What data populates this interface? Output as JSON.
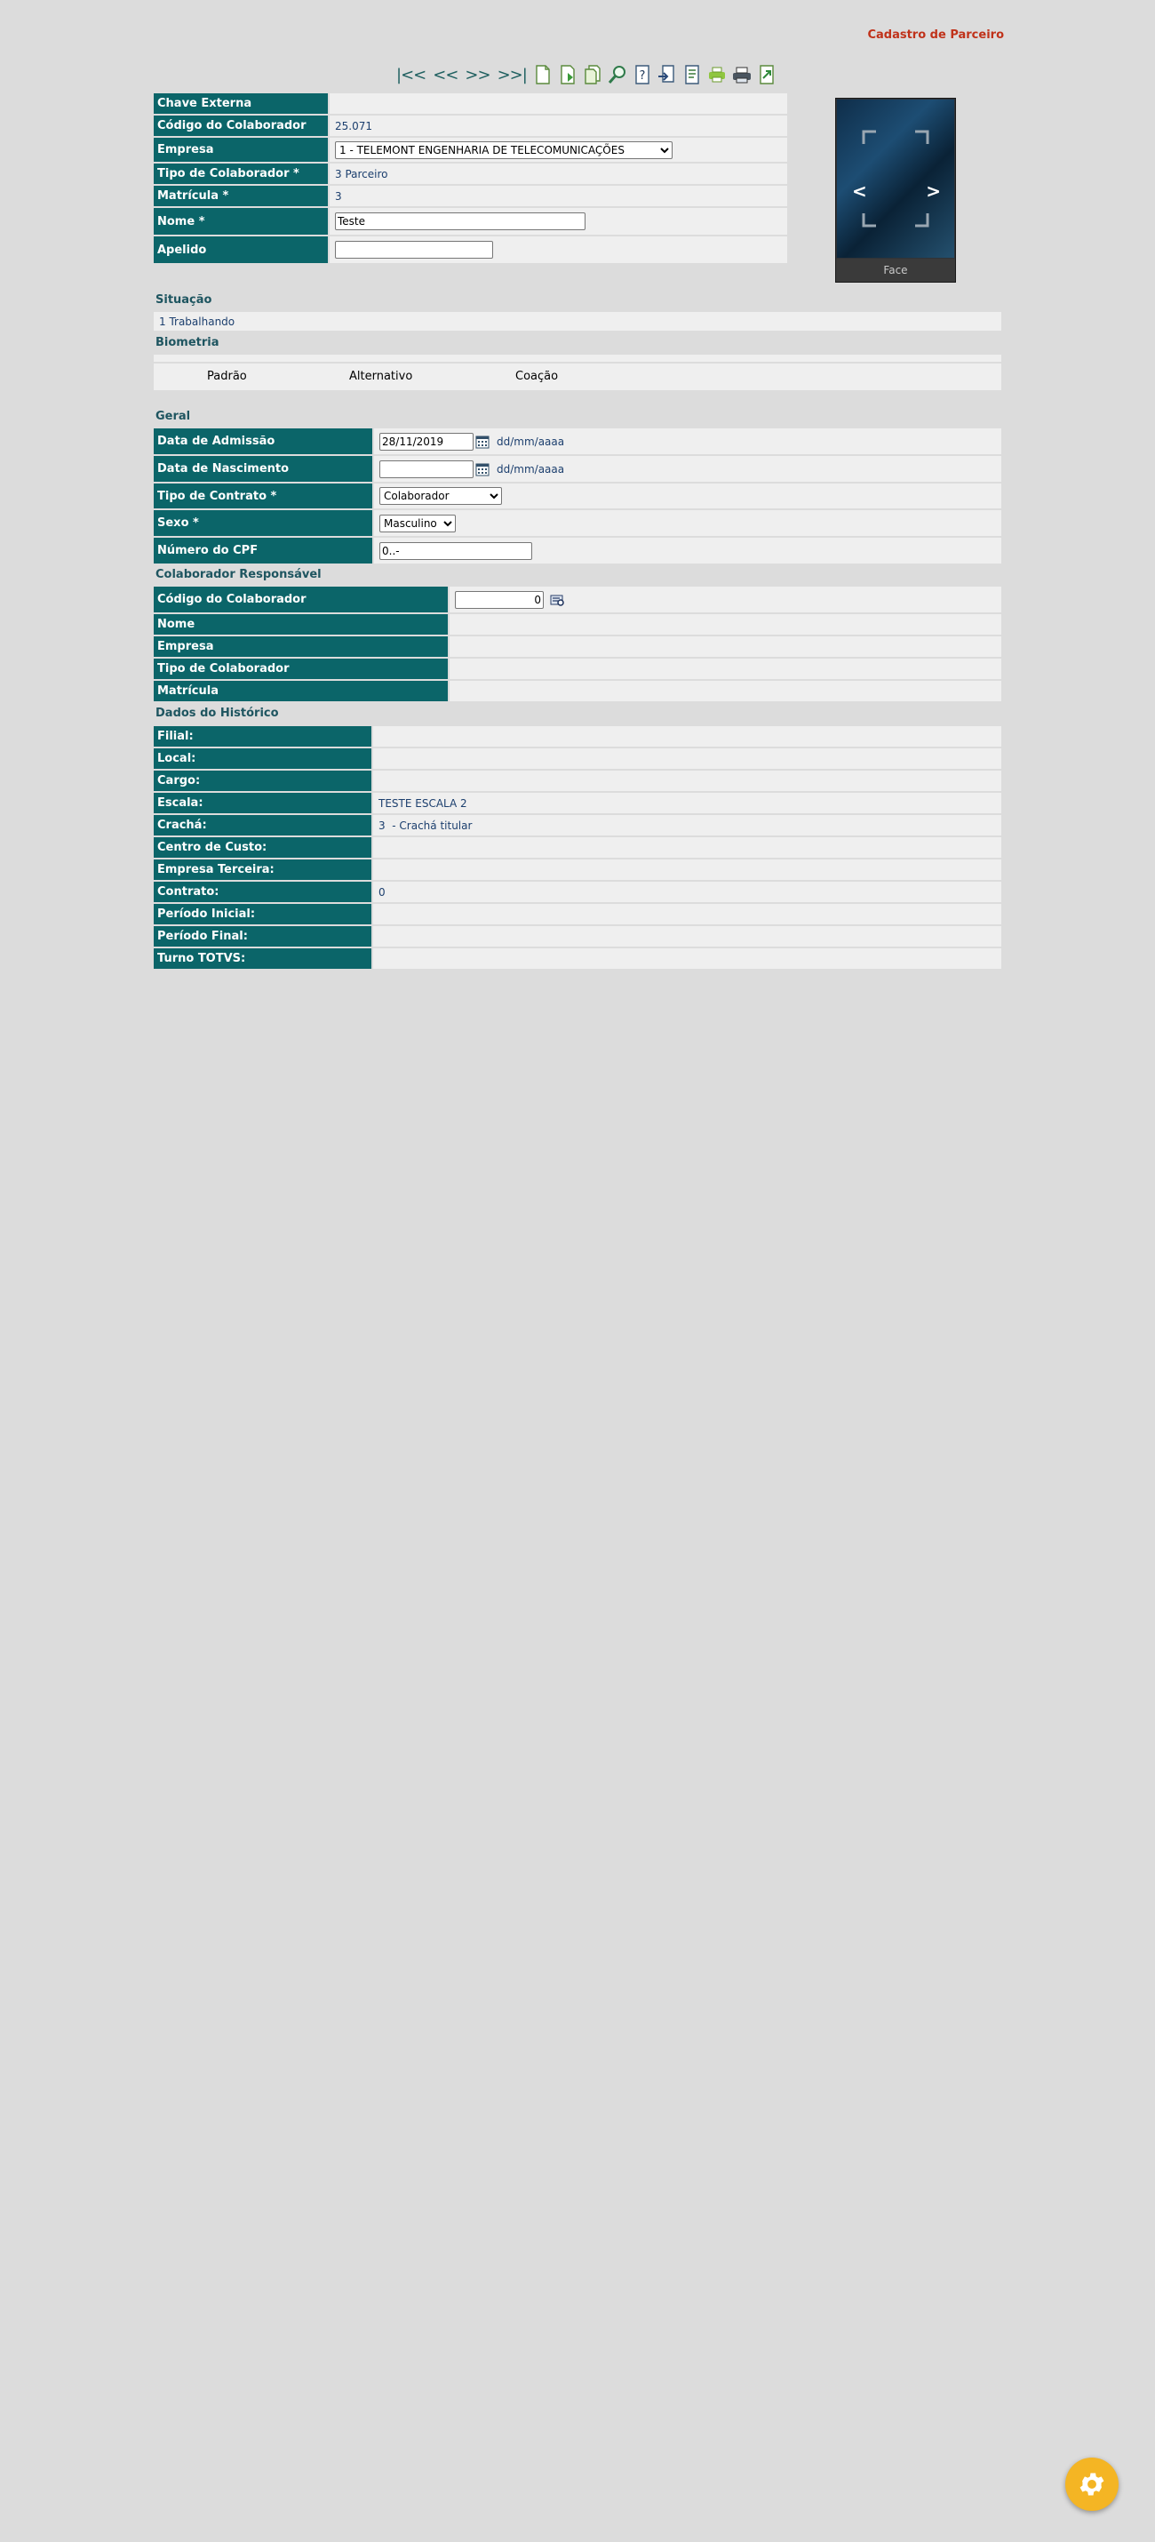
{
  "page_title": "Cadastro de Parceiro",
  "toolbar": {
    "nav": [
      "|<<",
      "<<",
      ">>",
      ">>|"
    ],
    "icons": [
      "new-document-icon",
      "add-document-icon",
      "copy-document-icon",
      "search-icon",
      "help-icon",
      "import-icon",
      "report-icon",
      "print-icon",
      "printer-icon",
      "export-icon"
    ]
  },
  "header_fields": [
    {
      "label": "Chave Externa",
      "value": ""
    },
    {
      "label": "Código do Colaborador",
      "value": "25.071"
    },
    {
      "label": "Empresa",
      "value": "1 - TELEMONT ENGENHARIA DE TELECOMUNICAÇÕES"
    },
    {
      "label": "Tipo de Colaborador *",
      "value": "3 Parceiro"
    },
    {
      "label": "Matrícula *",
      "value": "3"
    },
    {
      "label": "Nome *",
      "value": "Teste"
    },
    {
      "label": "Apelido",
      "value": ""
    }
  ],
  "photo": {
    "caption": "Face",
    "prev": "<",
    "next": ">"
  },
  "situacao": {
    "title": "Situação",
    "value": "1 Trabalhando"
  },
  "biometria": {
    "title": "Biometria",
    "tabs": [
      "Padrão",
      "Alternativo",
      "Coação"
    ]
  },
  "geral": {
    "title": "Geral",
    "date_hint": "dd/mm/aaaa",
    "fields": [
      {
        "label": "Data de Admissão",
        "value": "28/11/2019"
      },
      {
        "label": "Data de Nascimento",
        "value": ""
      },
      {
        "label": "Tipo de Contrato *",
        "value": "Colaborador"
      },
      {
        "label": "Sexo *",
        "value": "Masculino"
      },
      {
        "label": "Número do CPF",
        "value": "0..-"
      }
    ]
  },
  "responsavel": {
    "title": "Colaborador Responsável",
    "fields": [
      {
        "label": "Código do Colaborador",
        "value": "0"
      },
      {
        "label": "Nome",
        "value": ""
      },
      {
        "label": "Empresa",
        "value": ""
      },
      {
        "label": "Tipo de Colaborador",
        "value": ""
      },
      {
        "label": "Matrícula",
        "value": ""
      }
    ]
  },
  "historico": {
    "title": "Dados do Histórico",
    "fields": [
      {
        "label": "Filial:",
        "value": ""
      },
      {
        "label": "Local:",
        "value": ""
      },
      {
        "label": "Cargo:",
        "value": ""
      },
      {
        "label": "Escala:",
        "value": "TESTE ESCALA 2"
      },
      {
        "label": "Crachá:",
        "value": "3  - Crachá titular"
      },
      {
        "label": "Centro de Custo:",
        "value": ""
      },
      {
        "label": "Empresa Terceira:",
        "value": ""
      },
      {
        "label": "Contrato:",
        "value": "0"
      },
      {
        "label": "Período Inicial:",
        "value": ""
      },
      {
        "label": "Período Final:",
        "value": ""
      },
      {
        "label": "Turno TOTVS:",
        "value": ""
      }
    ]
  },
  "colors": {
    "label_bg": "#0b6569",
    "value_bg": "#efefef",
    "title": "#c0321a",
    "fab": "#f4b524"
  }
}
